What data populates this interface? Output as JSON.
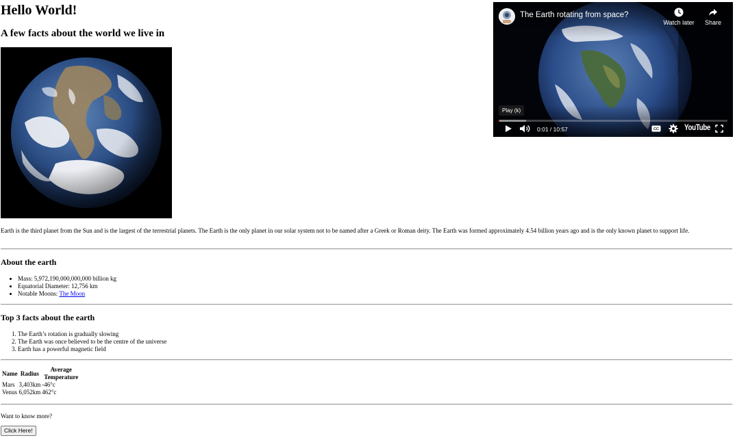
{
  "header": {
    "title": "Hello World!",
    "subtitle": "A few facts about the world we live in"
  },
  "video": {
    "title": "The Earth rotating from space?",
    "watch_later_label": "Watch later",
    "share_label": "Share",
    "tooltip": "Play (k)",
    "time": "0:01 / 10:57",
    "logo_text": "YouTube",
    "played_fraction": 0.002,
    "loaded_fraction": 0.12
  },
  "intro": "Earth is the third planet from the Sun and is the largest of the terrestrial planets. The Earth is the only planet in our solar system not to be named after a Greek or Roman deity. The Earth was formed approximately 4.54 billion years ago and is the only known planet to support life.",
  "about": {
    "heading": "About the earth",
    "items": [
      "Mass: 5,972,190,000,000,000 billion kg",
      "Equatorial Diameter: 12,756 km"
    ],
    "moons_label": "Notable Moons: ",
    "moons_link": "The Moon"
  },
  "facts": {
    "heading": "Top 3 facts about the earth",
    "items": [
      "The Earth’s rotation is gradually slowing",
      "The Earth was once believed to be the centre of the universe",
      "Earth has a powerful magnetic field"
    ]
  },
  "table": {
    "headers": [
      "Name",
      "Radius",
      "Average Temperature"
    ],
    "rows": [
      [
        "Mars",
        "3,403km",
        "-46°c"
      ],
      [
        "Venus",
        "6,052km",
        "462°c"
      ]
    ]
  },
  "more": {
    "text": "Want to know more?",
    "button_label": "Click Here!"
  },
  "colors": {
    "link": "#0000ee",
    "progress": "#ff0000",
    "video_background": "#02040a"
  }
}
